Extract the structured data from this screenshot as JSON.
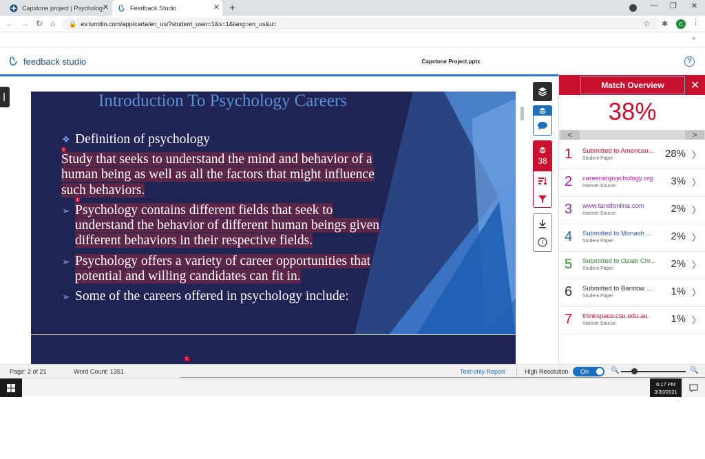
{
  "browser": {
    "tabs": [
      {
        "title": "Capstone project | Psychology h…",
        "icon": "site-favicon"
      },
      {
        "title": "Feedback Studio",
        "icon": "turnitin-favicon"
      }
    ],
    "url": "ev.turnitin.com/app/carta/en_us/?student_user=1&s=1&lang=en_us&u=",
    "avatar_letter": "C",
    "new_tab": "+",
    "overflow": "»"
  },
  "app": {
    "logo_text": "feedback studio",
    "filename": "Capstone Project.pptx",
    "help": "?"
  },
  "slide": {
    "title": "Introduction To Psychology Careers",
    "lines": [
      "Definition of psychology",
      "Study that seeks to understand the mind and behavior of a",
      "human being as well as all the factors that might influence",
      "such behaviors.",
      "Psychology contains different fields that seek to",
      "understand the behavior of different human beings given",
      "different behaviors in their respective fields.",
      "Psychology offers a variety of career opportunities that",
      "potential and willing candidates can fit in.",
      "Some of the careers offered in psychology include:"
    ],
    "marker": "1"
  },
  "tools": {
    "match_count": "38"
  },
  "panel": {
    "title": "Match Overview",
    "percent": "38%",
    "prev": "<",
    "next": ">",
    "matches": [
      {
        "rank": "1",
        "source": "Submitted to American...",
        "type": "Student Paper",
        "pct": "28%",
        "color": "#c8102e"
      },
      {
        "rank": "2",
        "source": "careersinpsychology.org",
        "type": "Internet Source",
        "pct": "3%",
        "color": "#b5179e"
      },
      {
        "rank": "3",
        "source": "www.tandfonline.com",
        "type": "Internet Source",
        "pct": "2%",
        "color": "#7b2fa8"
      },
      {
        "rank": "4",
        "source": "Submitted to Monash ...",
        "type": "Student Paper",
        "pct": "2%",
        "color": "#2a5fb0"
      },
      {
        "rank": "5",
        "source": "Submitted to Ozark Chr...",
        "type": "Student Paper",
        "pct": "2%",
        "color": "#2e8b2e"
      },
      {
        "rank": "6",
        "source": "Submitted to Barstow ...",
        "type": "Student Paper",
        "pct": "1%",
        "color": "#333333"
      },
      {
        "rank": "7",
        "source": "thinkspace.csu.edu.au",
        "type": "Internet Source",
        "pct": "1%",
        "color": "#c8102e"
      }
    ]
  },
  "status": {
    "page": "Page: 2 of 21",
    "word_count": "Word Count: 1351",
    "text_only": "Text-only Report",
    "hires_label": "High Resolution",
    "hires_state": "On"
  },
  "taskbar": {
    "time": "6:17 PM",
    "date": "3/30/2021"
  }
}
